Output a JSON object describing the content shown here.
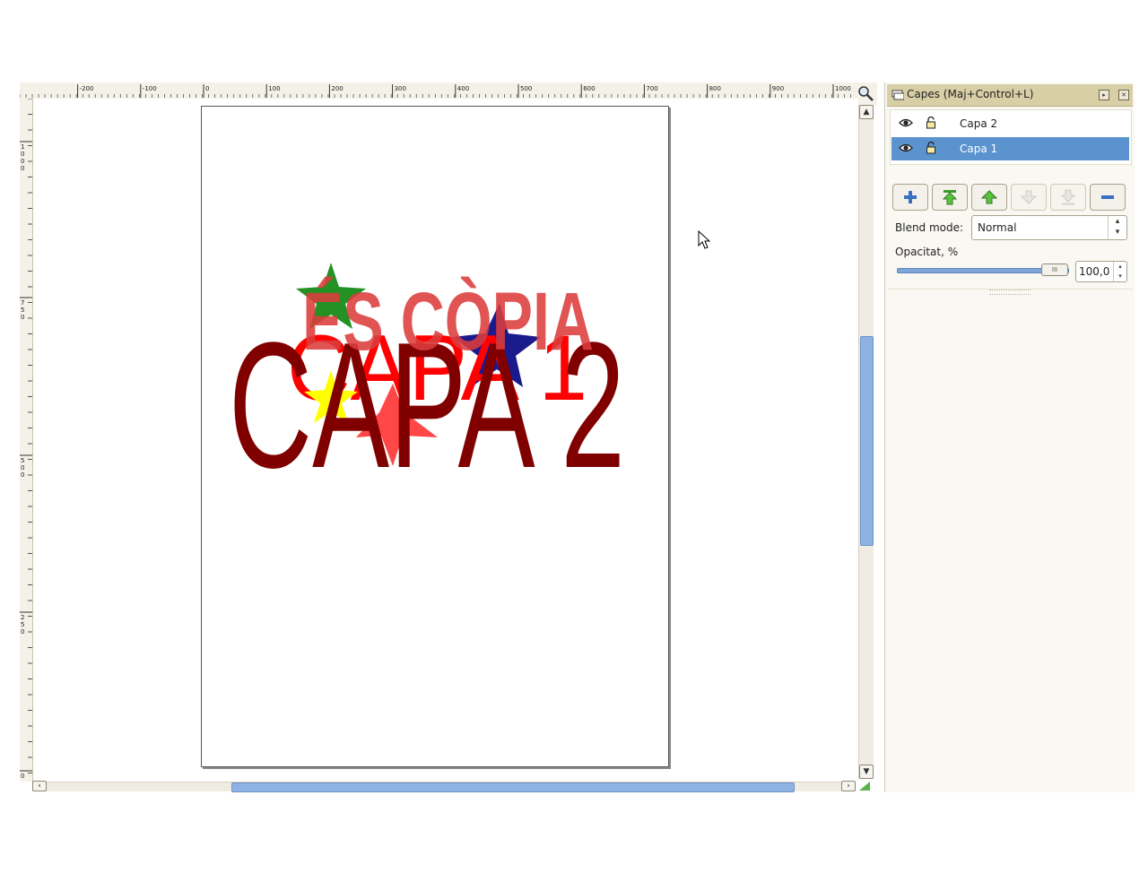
{
  "ruler": {
    "h_labels": [
      "-200",
      "-100",
      "0",
      "100",
      "200",
      "300",
      "400",
      "500",
      "600",
      "700",
      "800",
      "900",
      "1000"
    ],
    "v_labels": [
      "1000",
      "750",
      "500",
      "250",
      "0"
    ]
  },
  "canvas": {
    "watermark": "ÉS CÒPIA",
    "layer1_text": "CAPA 1",
    "layer2_text": "CAPA 2",
    "colors": {
      "watermark": "#dc3c3c",
      "layer1_text": "#ff0000",
      "layer2_text": "#800000",
      "star_green": "#239123",
      "star_blue": "#1a1a8c",
      "star_red": "#ff3333",
      "star_yellow": "#ffff00"
    }
  },
  "dock": {
    "title": "Capes (Maj+Control+L)",
    "layers": [
      {
        "name": "Capa 2",
        "selected": false,
        "visible": true,
        "locked": false
      },
      {
        "name": "Capa 1",
        "selected": true,
        "visible": true,
        "locked": false
      }
    ],
    "buttons": [
      "add-layer",
      "raise-layer-to-top",
      "raise-layer",
      "lower-layer",
      "lower-layer-to-bottom",
      "remove-layer"
    ],
    "blend_label": "Blend mode:",
    "blend_mode": "Normal",
    "opacity_label": "Opacitat, %",
    "opacity_value": "100,0",
    "opacity_fraction": 1.0
  },
  "accent_color": "#5b93cf"
}
